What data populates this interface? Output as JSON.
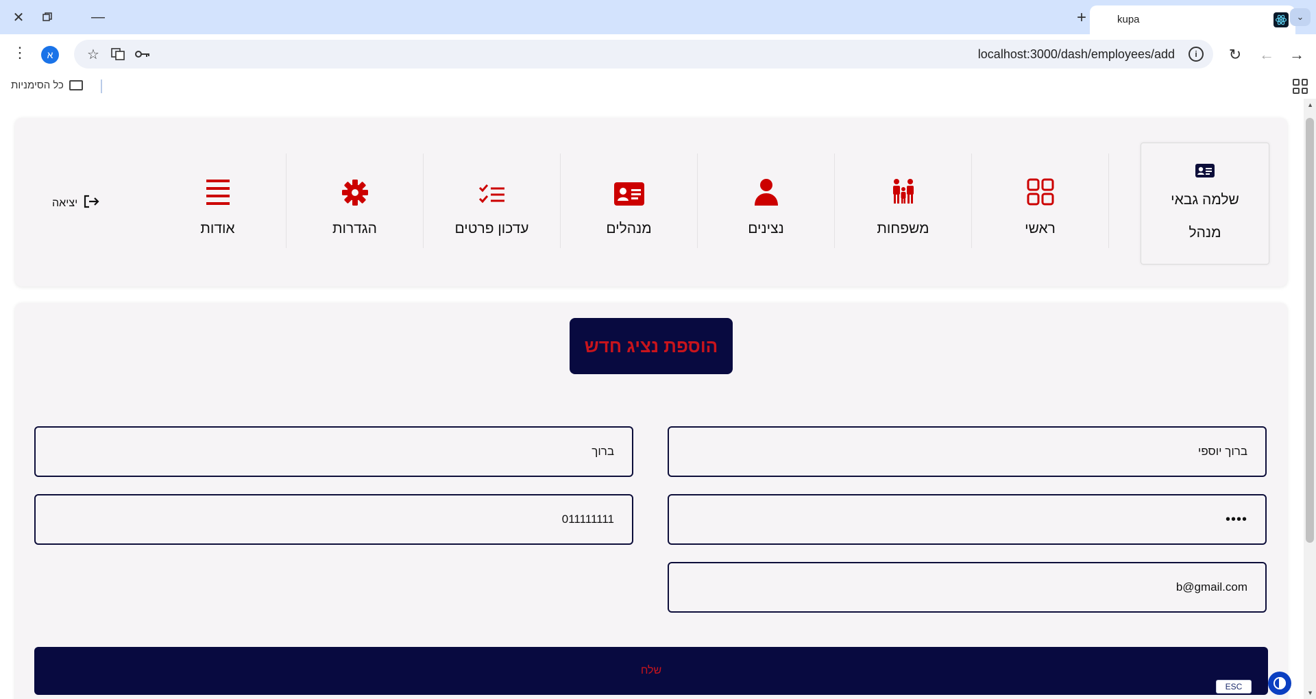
{
  "browser": {
    "tab_title": "kupa",
    "url": "localhost:3000/dash/employees/add",
    "profile_initial": "א",
    "bookmarks_label": "כל הסימניות"
  },
  "nav": {
    "profile_name": "שלמה גבאי",
    "profile_role": "מנהל",
    "items": [
      {
        "label": "ראשי",
        "icon": "grid-icon"
      },
      {
        "label": "משפחות",
        "icon": "family-icon"
      },
      {
        "label": "נצינים",
        "icon": "user-icon"
      },
      {
        "label": "מנהלים",
        "icon": "id-card-icon"
      },
      {
        "label": "עדכון פרטים",
        "icon": "checklist-icon"
      },
      {
        "label": "הגדרות",
        "icon": "gear-icon"
      },
      {
        "label": "אודות",
        "icon": "menu-lines-icon"
      }
    ],
    "logout_label": "יציאה"
  },
  "form": {
    "title": "הוספת נציג חדש",
    "full_name_value": "ברוך יוספי",
    "username_value": "ברוך",
    "password_value": "••••",
    "phone_value": "011111111",
    "email_value": "b@gmail.com",
    "submit_label": "שלח"
  },
  "overlay": {
    "esc_label": "ESC"
  },
  "colors": {
    "accent_red": "#c8141c",
    "navy": "#080a40",
    "card_bg": "#f6f4f6"
  }
}
